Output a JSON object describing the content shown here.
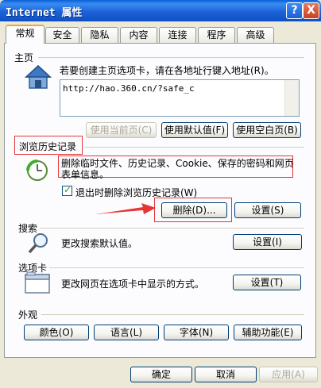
{
  "window": {
    "title": "Internet 属性",
    "help": "?",
    "close": "X"
  },
  "tabs": [
    "常规",
    "安全",
    "隐私",
    "内容",
    "连接",
    "程序",
    "高级"
  ],
  "homepage": {
    "group": "主页",
    "desc": "若要创建主页选项卡，请在各地址行键入地址(R)。",
    "url": "http://hao.360.cn/?safe_c",
    "buttons": [
      "使用当前页(C)",
      "使用默认值(F)",
      "使用空白页(B)"
    ]
  },
  "history": {
    "group": "浏览历史记录",
    "desc_line1": "删除临时文件、历史记录、Cookie、保存的密码和网页",
    "desc_line2": "表单信息。",
    "checkbox": "退出时删除浏览历史记录(W)",
    "delete": "删除(D)...",
    "settings": "设置(S)"
  },
  "search": {
    "group": "搜索",
    "desc": "更改搜索默认值。",
    "settings": "设置(I)"
  },
  "tabs_section": {
    "group": "选项卡",
    "desc": "更改网页在选项卡中显示的方式。",
    "settings": "设置(T)"
  },
  "appearance": {
    "group": "外观",
    "buttons": [
      "颜色(O)",
      "语言(L)",
      "字体(N)",
      "辅助功能(E)"
    ]
  },
  "footer": {
    "ok": "确定",
    "cancel": "取消",
    "apply": "应用(A)"
  },
  "colors": {
    "annotation": "#e53636",
    "titlebar": "#0a5fd8"
  }
}
